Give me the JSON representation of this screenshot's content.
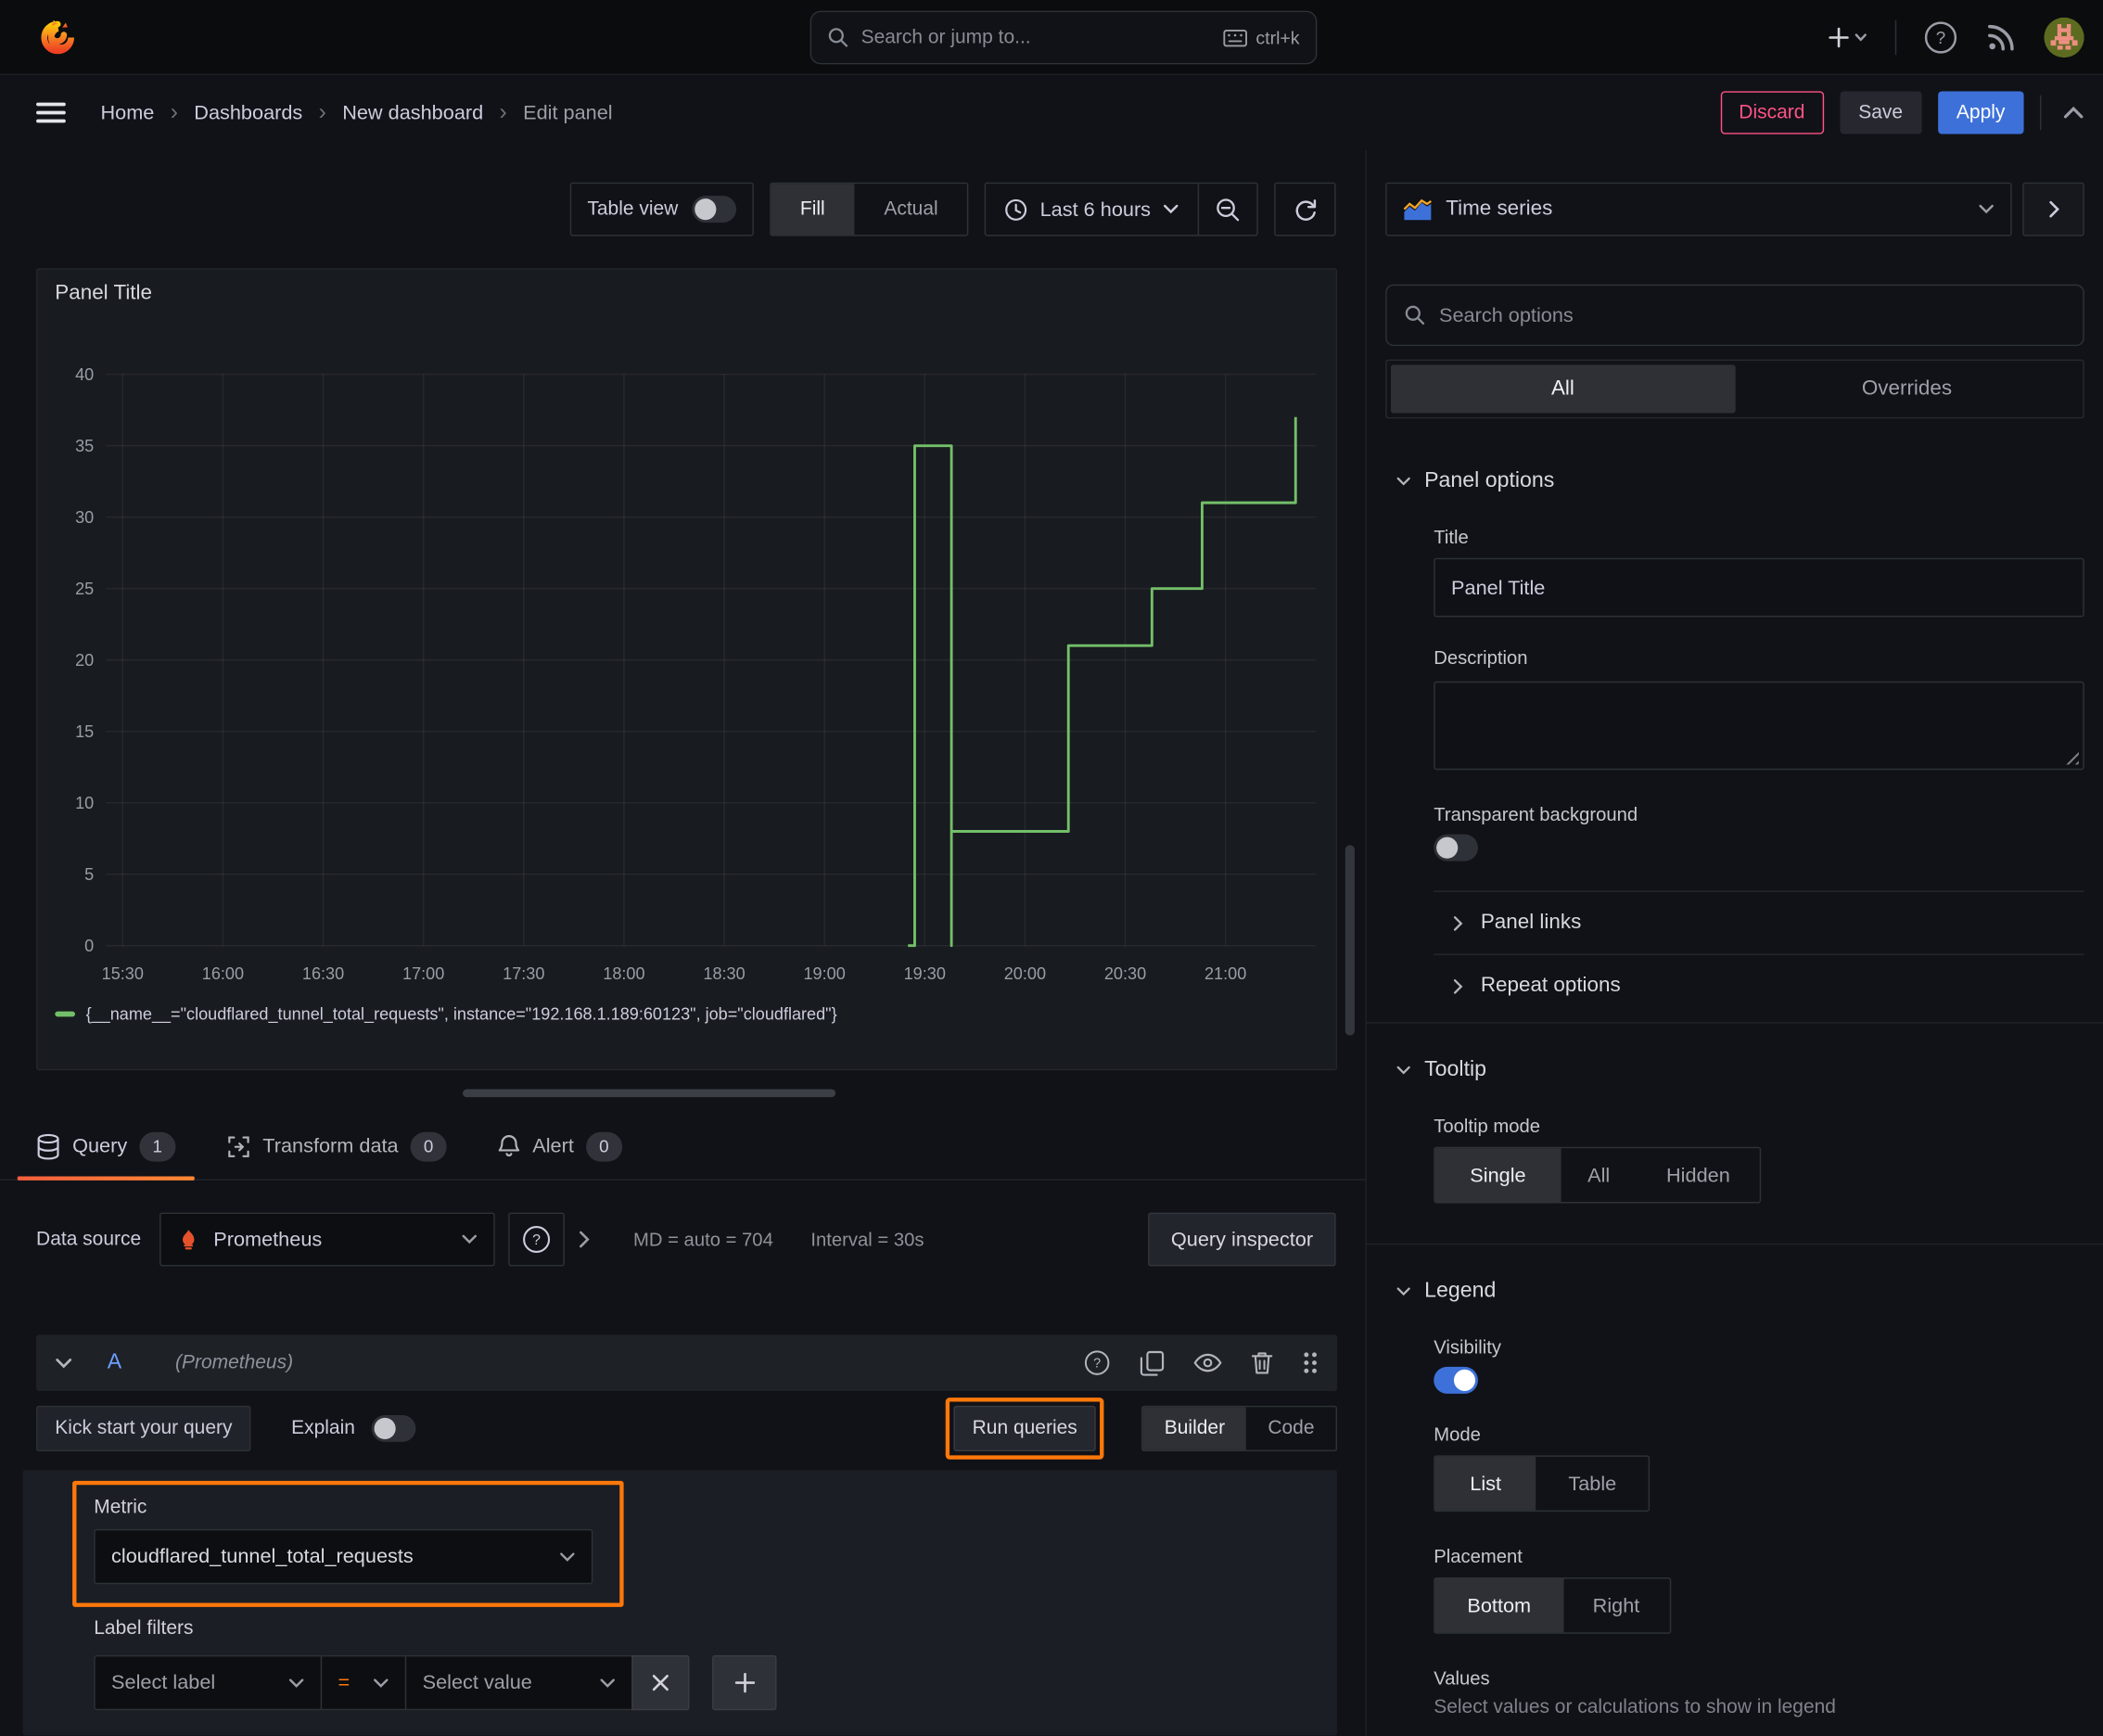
{
  "colors": {
    "accent": "#ff780a",
    "blue": "#3d71d9",
    "green": "#73bf69",
    "pink": "#ff5286"
  },
  "topbar": {
    "search_placeholder": "Search or jump to...",
    "shortcut": "ctrl+k"
  },
  "nav": {
    "breadcrumb": {
      "separator": "›",
      "items": [
        {
          "label": "Home"
        },
        {
          "label": "Dashboards"
        },
        {
          "label": "New dashboard"
        },
        {
          "label": "Edit panel"
        }
      ]
    },
    "discard": "Discard",
    "save": "Save",
    "apply": "Apply"
  },
  "toolbar": {
    "table_view": "Table view",
    "fill": "Fill",
    "actual": "Actual",
    "time_range": "Last 6 hours"
  },
  "panel": {
    "title": "Panel Title"
  },
  "chart_data": {
    "type": "line",
    "style": "step",
    "title": "Panel Title",
    "xlabel": "",
    "ylabel": "",
    "ylim": [
      0,
      40
    ],
    "yticks": [
      0,
      5,
      10,
      15,
      20,
      25,
      30,
      35,
      40
    ],
    "xticks": [
      "15:30",
      "16:00",
      "16:30",
      "17:00",
      "17:30",
      "18:00",
      "18:30",
      "19:00",
      "19:30",
      "20:00",
      "20:30",
      "21:00"
    ],
    "x_range": [
      "15:25",
      "21:27"
    ],
    "grid": true,
    "legend_position": "bottom",
    "series": [
      {
        "name": "{__name__=\"cloudflared_tunnel_total_requests\", instance=\"192.168.1.189:60123\", job=\"cloudflared\"}",
        "color": "#73bf69",
        "points": [
          [
            "19:25",
            0
          ],
          [
            "19:27",
            0
          ],
          [
            "19:27",
            35
          ],
          [
            "19:38",
            35
          ],
          [
            "19:38",
            0
          ],
          [
            "19:38",
            8
          ],
          [
            "20:13",
            8
          ],
          [
            "20:13",
            21
          ],
          [
            "20:38",
            21
          ],
          [
            "20:38",
            25
          ],
          [
            "20:53",
            25
          ],
          [
            "20:53",
            31
          ],
          [
            "21:21",
            31
          ],
          [
            "21:21",
            37
          ]
        ]
      }
    ]
  },
  "tabs": {
    "query": "Query",
    "query_count": "1",
    "transform": "Transform data",
    "transform_count": "0",
    "alert": "Alert",
    "alert_count": "0"
  },
  "datasource": {
    "label": "Data source",
    "name": "Prometheus",
    "max_data_points": "MD = auto = 704",
    "interval": "Interval = 30s",
    "inspector": "Query inspector"
  },
  "query": {
    "ref": "A",
    "ds_hint": "(Prometheus)",
    "kick_start": "Kick start your query",
    "explain": "Explain",
    "run_queries": "Run queries",
    "builder": "Builder",
    "code": "Code",
    "metric_label": "Metric",
    "metric_value": "cloudflared_tunnel_total_requests",
    "label_filters_label": "Label filters",
    "select_label": "Select label",
    "operator": "=",
    "select_value": "Select value"
  },
  "options": {
    "visualization": "Time series",
    "search_placeholder": "Search options",
    "tabs": {
      "all": "All",
      "overrides": "Overrides"
    },
    "panel_options": {
      "heading": "Panel options",
      "title_label": "Title",
      "title_value": "Panel Title",
      "description_label": "Description",
      "transparent_label": "Transparent background"
    },
    "panel_links": "Panel links",
    "repeat_options": "Repeat options",
    "tooltip": {
      "heading": "Tooltip",
      "mode_label": "Tooltip mode",
      "modes": [
        "Single",
        "All",
        "Hidden"
      ]
    },
    "legend": {
      "heading": "Legend",
      "visibility_label": "Visibility",
      "mode_label": "Mode",
      "modes": [
        "List",
        "Table"
      ],
      "placement_label": "Placement",
      "placements": [
        "Bottom",
        "Right"
      ],
      "values_label": "Values",
      "values_hint": "Select values or calculations to show in legend"
    }
  }
}
